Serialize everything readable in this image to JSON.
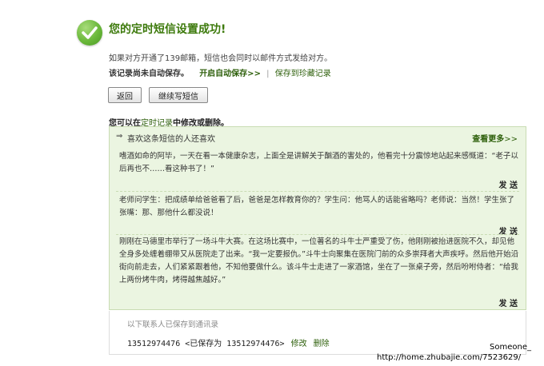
{
  "icons": {
    "success": "check-circle-icon",
    "arrow": "double-arrow-right-icon"
  },
  "colors": {
    "accent_green": "#3d7a0c",
    "panel_bg": "#ebf5e1",
    "panel_border": "#c9dcb3"
  },
  "header": {
    "title": "您的定时短信设置成功!",
    "info": "如果对方开通了139邮箱，短信也会同时以邮件方式发给对方。"
  },
  "save": {
    "not_saved": "该记录尚未自动保存。",
    "enable_auto": "开启自动保存>>",
    "separator": "|",
    "save_collection": "保存到珍藏记录"
  },
  "buttons": {
    "back": "返回",
    "continue": "继续写短信"
  },
  "manage": {
    "prefix": "您可以在",
    "link": "定时记录",
    "suffix": "中修改或删除。"
  },
  "recommend": {
    "arrow": "⇒",
    "heading": "喜欢这条短信的人还喜欢",
    "more": "查看更多",
    "more_chevron": ">>",
    "messages": [
      {
        "text": "嗜酒如命的阿毕，一天在看一本健康杂志，上面全是讲解关于酗酒的害处的，他看完十分震惊地站起来感慨道：“老子以后再也不……看这种书了！”",
        "send": "发 送"
      },
      {
        "text": "老师问学生：把成绩单给爸爸看了后，爸爸是怎样教育你的？学生问：他骂人的话能省略吗？老师说：当然！学生张了张嘴：那、那他什么都没说！",
        "send": "发 送"
      },
      {
        "text": "刚刚在马德里市举行了一场斗牛大赛。在这场比赛中，一位著名的斗牛士严重受了伤，他刚刚被抬进医院不久，却见他全身多处缠着绷带又从医院走了出来。“我一定要报仇。”斗牛士向聚集在医院门前的众多崇拜者大声疾呼。然后他开始沿街向前走去，人们紧紧跟着他，不知他要做什么。该斗牛士走进了一家酒馆，坐在了一张桌子旁，然后吩咐侍者：“给我上两份烤牛肉，烤得越焦越好。”",
        "send": "发 送"
      }
    ]
  },
  "contacts": {
    "note": "以下联系人已保存到通讯录",
    "number": "13512974476",
    "saved_as": "<已保存为 13512974476>",
    "edit": "修改",
    "delete": "删除"
  },
  "watermark": {
    "user": "Someone_",
    "url": "http://home.zhubajie.com/7523629/"
  }
}
